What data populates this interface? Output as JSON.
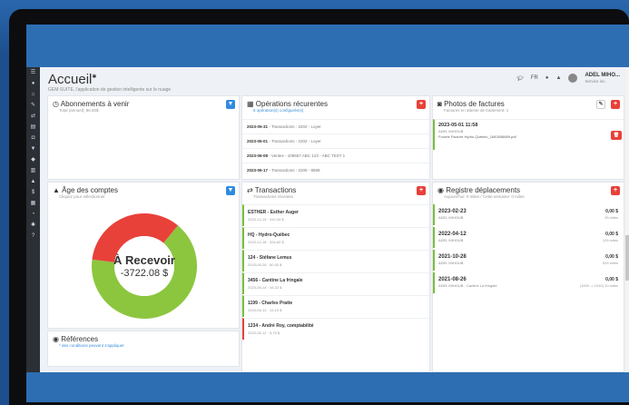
{
  "header": {
    "title": "Accueil",
    "subtitle": "GEM-SUITE, l'application de gestion intelligente sur le nuage",
    "lang": "FR",
    "user_name": "ADEL MIHO...",
    "user_role": "Service inc."
  },
  "abonnements": {
    "title": "Abonnements à venir",
    "subtitle": "Total (annuel): 86.60$"
  },
  "operations": {
    "title": "Opérations récurentes",
    "subtitle": "6 opération(s) configurée(s)",
    "items": [
      {
        "date": "2023-05-31",
        "desc": " - Transactions - 2202 - Loyer"
      },
      {
        "date": "2023-06-01",
        "desc": " - Transactions - 2202 - Loyer"
      },
      {
        "date": "2023-06-08",
        "desc": " - Ventes - 109657 ABC 123 - ABC TEST 1"
      },
      {
        "date": "2023-06-17",
        "desc": " - Transactions - 2205 - 8589"
      }
    ]
  },
  "photos": {
    "title": "Photos de factures",
    "subtitle": "Factures en attente de traitement: 1",
    "item_date": "2023-05-01 11:58",
    "item_user": "ADEL MIHOUB",
    "item_file": "Fournir Facture Hydro-Québec_1682656689.pdf"
  },
  "age": {
    "title": "Âge des comptes",
    "subtitle": "Cliquez pour sélectionner",
    "center_label": "À Recevoir",
    "center_value": "-3722.08 $",
    "green_fraction": 0.66
  },
  "transactions": {
    "title": "Transactions",
    "subtitle": "Transactions récentes",
    "items": [
      {
        "name": "ESTHER - Esther Auger",
        "detail": "2023-12-15 · 410,34 $",
        "status": "green"
      },
      {
        "name": "HQ - Hydro-Québec",
        "detail": "2023-12-18 · 334,82 $",
        "status": "green"
      },
      {
        "name": "124 - Stéfane Lemus",
        "detail": "2023-05-26 · 60,00 $",
        "status": "green"
      },
      {
        "name": "3456 - Cantine La fringale",
        "detail": "2023-05-14 · 15,22 $",
        "status": "green"
      },
      {
        "name": "1199 - Charles Pratte",
        "detail": "2023-05-13 · 13,10 $",
        "status": "green"
      },
      {
        "name": "1234 - André Roy, comptabilité",
        "detail": "2023-05-12 · 5,75 $",
        "status": "red"
      }
    ]
  },
  "registre": {
    "title": "Registre déplacements",
    "subtitle": "Aujourd'hui: 0 miles / Cette semaine: 0 miles",
    "items": [
      {
        "date": "2023-02-23",
        "who": "ADEL MIHOUB",
        "amount": "0,00 $",
        "miles": "25 miles"
      },
      {
        "date": "2022-04-12",
        "who": "ADEL MIHOUB",
        "amount": "0,00 $",
        "miles": "125 miles"
      },
      {
        "date": "2021-10-28",
        "who": "ADEL MIHOUB",
        "amount": "0,00 $",
        "miles": "525 miles"
      },
      {
        "date": "2021-08-26",
        "who": "ADEL MIHOUB - Cantine La fringale",
        "amount": "0,00 $",
        "miles": "(1000 -> 1010) 10 miles"
      }
    ]
  },
  "references": {
    "title": "Références",
    "subtitle": "* des conditions peuvent s'appliquer"
  },
  "colors": {
    "green": "#8cc63f",
    "red": "#e8413a",
    "blue": "#2f8be0",
    "screen": "#2d6eb3"
  }
}
